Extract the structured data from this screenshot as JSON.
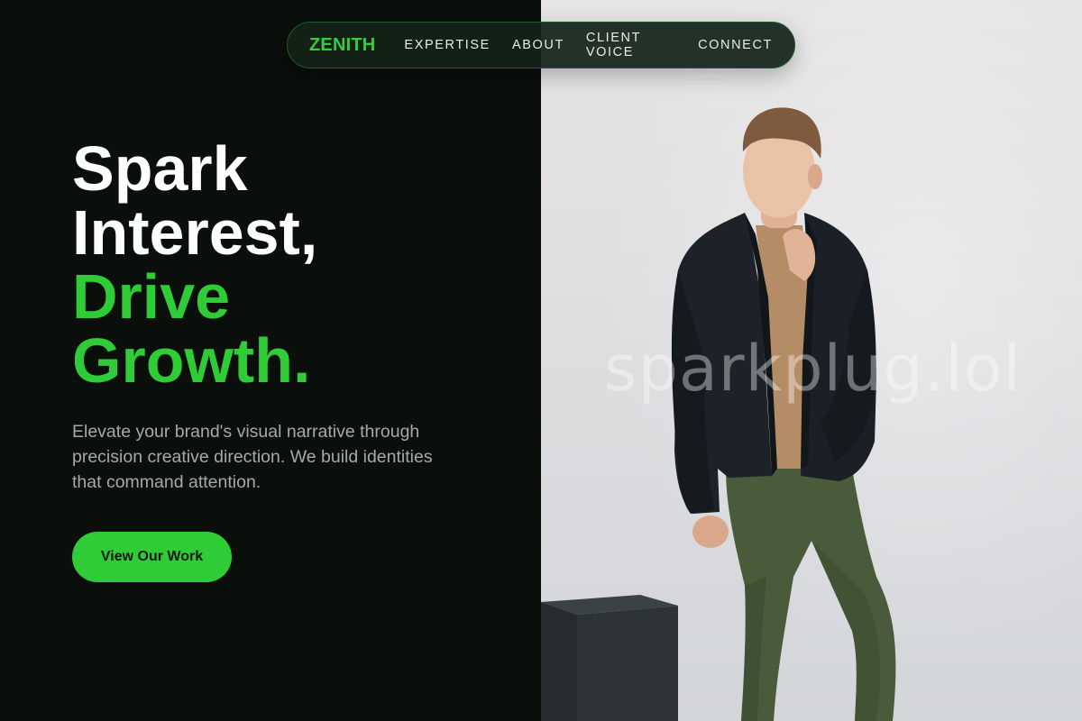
{
  "nav": {
    "brand": "ZENITH",
    "links": [
      "EXPERTISE",
      "ABOUT",
      "CLIENT VOICE",
      "CONNECT"
    ]
  },
  "hero": {
    "title_lines": [
      "Spark",
      "Interest,"
    ],
    "accent_lines": [
      "Drive",
      "Growth."
    ],
    "subtitle": "Elevate your brand's visual narrative through precision creative direction. We build identities that command attention.",
    "cta_label": "View Our Work"
  },
  "image": {
    "watermark": "sparkplug.lol",
    "subject": "man-in-dark-blazer-and-green-trousers"
  },
  "colors": {
    "background": "#0a0f0b",
    "accent": "#2fcc37",
    "text": "#ffffff",
    "muted": "#a4aaa6"
  }
}
